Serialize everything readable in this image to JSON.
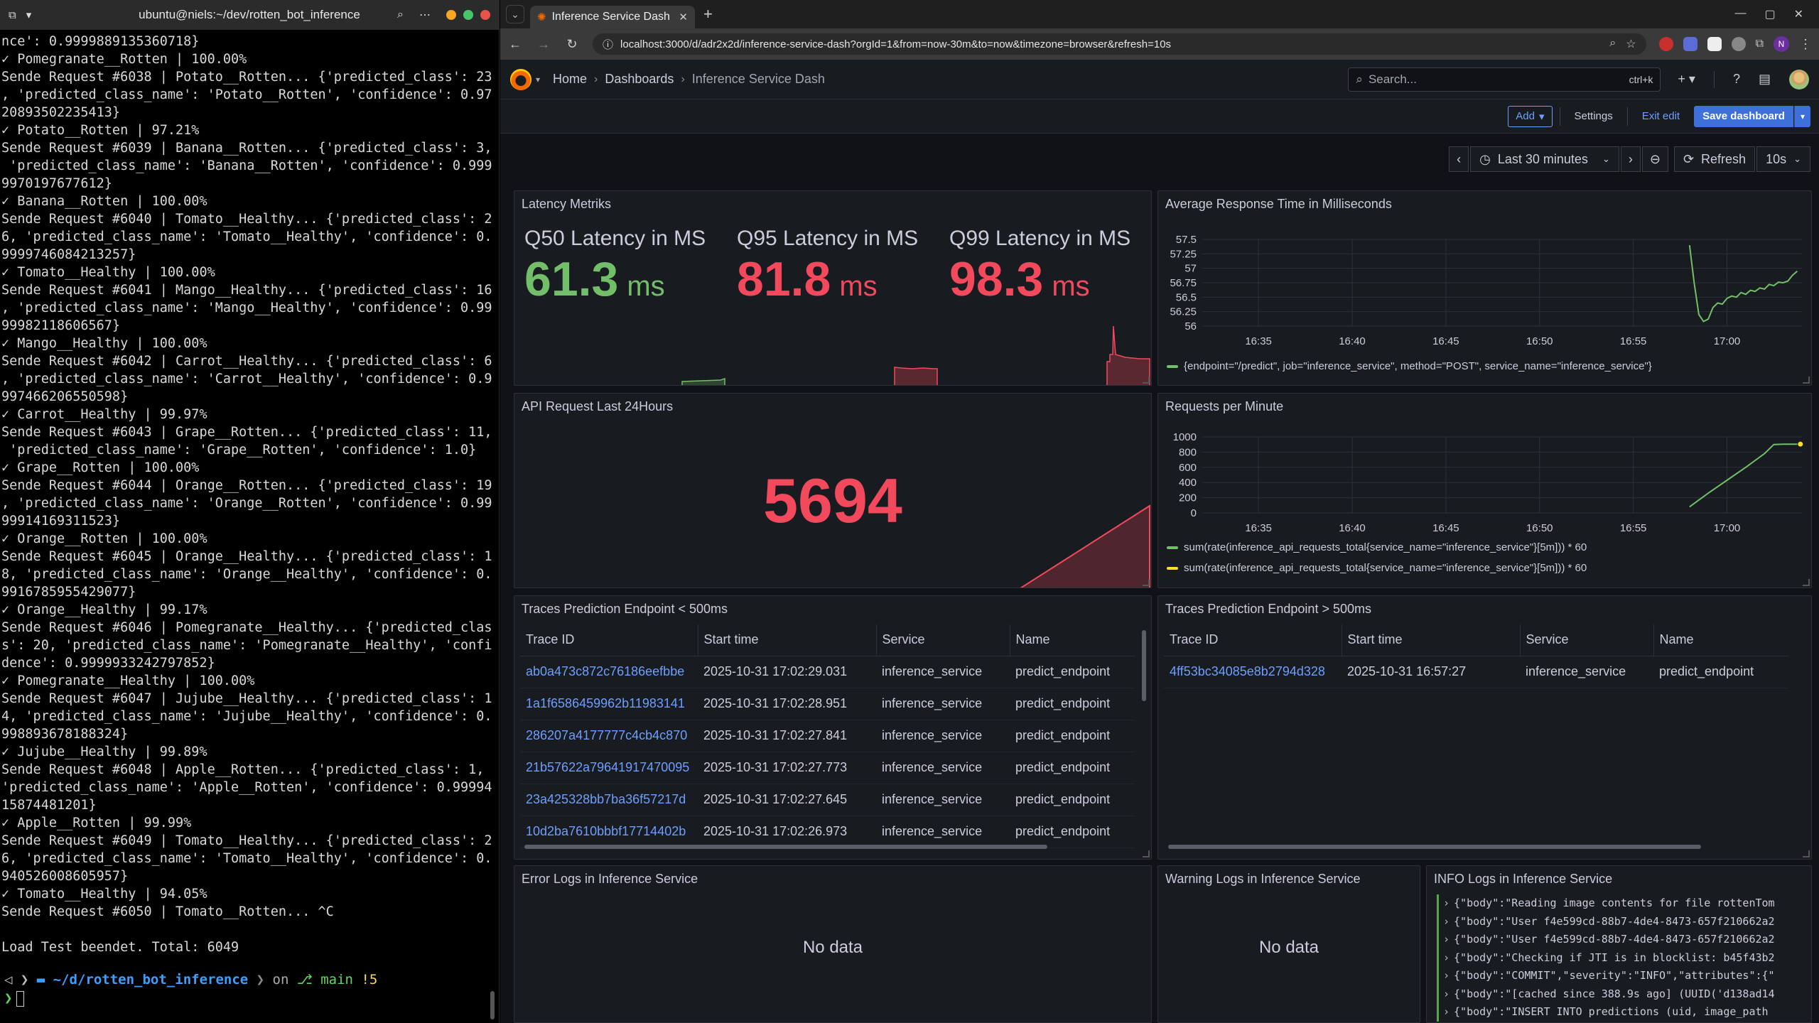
{
  "terminal": {
    "title": "ubuntu@niels:~/dev/rotten_bot_inference",
    "lines": [
      "nce': 0.9999889135360718}",
      "✓ Pomegranate__Rotten | 100.00%",
      "Sende Request #6038 | Potato__Rotten... {'predicted_class': 23",
      ", 'predicted_class_name': 'Potato__Rotten', 'confidence': 0.97",
      "20893502235413}",
      "✓ Potato__Rotten | 97.21%",
      "Sende Request #6039 | Banana__Rotten... {'predicted_class': 3,",
      " 'predicted_class_name': 'Banana__Rotten', 'confidence': 0.999",
      "9970197677612}",
      "✓ Banana__Rotten | 100.00%",
      "Sende Request #6040 | Tomato__Healthy... {'predicted_class': 2",
      "6, 'predicted_class_name': 'Tomato__Healthy', 'confidence': 0.",
      "9999746084213257}",
      "✓ Tomato__Healthy | 100.00%",
      "Sende Request #6041 | Mango__Healthy... {'predicted_class': 16",
      ", 'predicted_class_name': 'Mango__Healthy', 'confidence': 0.99",
      "99982118606567}",
      "✓ Mango__Healthy | 100.00%",
      "Sende Request #6042 | Carrot__Healthy... {'predicted_class': 6",
      ", 'predicted_class_name': 'Carrot__Healthy', 'confidence': 0.9",
      "997466206550598}",
      "✓ Carrot__Healthy | 99.97%",
      "Sende Request #6043 | Grape__Rotten... {'predicted_class': 11,",
      " 'predicted_class_name': 'Grape__Rotten', 'confidence': 1.0}",
      "✓ Grape__Rotten | 100.00%",
      "Sende Request #6044 | Orange__Rotten... {'predicted_class': 19",
      ", 'predicted_class_name': 'Orange__Rotten', 'confidence': 0.99",
      "99914169311523}",
      "✓ Orange__Rotten | 100.00%",
      "Sende Request #6045 | Orange__Healthy... {'predicted_class': 1",
      "8, 'predicted_class_name': 'Orange__Healthy', 'confidence': 0.",
      "9916785955429077}",
      "✓ Orange__Healthy | 99.17%",
      "Sende Request #6046 | Pomegranate__Healthy... {'predicted_clas",
      "s': 20, 'predicted_class_name': 'Pomegranate__Healthy', 'confi",
      "dence': 0.9999933242797852}",
      "✓ Pomegranate__Healthy | 100.00%",
      "Sende Request #6047 | Jujube__Healthy... {'predicted_class': 1",
      "4, 'predicted_class_name': 'Jujube__Healthy', 'confidence': 0.",
      "998893678188324}",
      "✓ Jujube__Healthy | 99.89%",
      "Sende Request #6048 | Apple__Rotten... {'predicted_class': 1,",
      "'predicted_class_name': 'Apple__Rotten', 'confidence': 0.99994",
      "15874481201}",
      "✓ Apple__Rotten | 99.99%",
      "Sende Request #6049 | Tomato__Healthy... {'predicted_class': 2",
      "6, 'predicted_class_name': 'Tomato__Healthy', 'confidence': 0.",
      "940526008605957}",
      "✓ Tomato__Healthy | 94.05%",
      "Sende Request #6050 | Tomato__Rotten... ^C",
      "",
      "Load Test beendet. Total: 6049"
    ],
    "prompt": {
      "dir_prefix": "~/d/",
      "dir_name": "rotten_bot_inference",
      "on": "on",
      "branch": "main",
      "status": "!5",
      "cursor_char": "❯"
    }
  },
  "browser": {
    "tab_title": "Inference Service Dash",
    "url": "localhost:3000/d/adr2x2d/inference-service-dash?orgId=1&from=now-30m&to=now&timezone=browser&refresh=10s",
    "profile_initial": "N"
  },
  "grafana": {
    "breadcrumbs": [
      "Home",
      "Dashboards",
      "Inference Service Dash"
    ],
    "search_placeholder": "Search...",
    "search_shortcut": "ctrl+k",
    "toolbar": {
      "add": "Add",
      "settings": "Settings",
      "exit_edit": "Exit edit",
      "save": "Save dashboard"
    },
    "timepicker": {
      "range": "Last 30 minutes",
      "refresh": "Refresh",
      "interval": "10s"
    },
    "colors": {
      "green": "#73bf69",
      "red": "#f2495c",
      "yellow": "#fade2a",
      "link": "#6e9fff"
    },
    "latency": {
      "title": "Latency Metriks",
      "stats": [
        {
          "label": "Q50 Latency in MS",
          "value": "61.3",
          "unit": "ms",
          "color": "#73bf69"
        },
        {
          "label": "Q95 Latency in MS",
          "value": "81.8",
          "unit": "ms",
          "color": "#f2495c"
        },
        {
          "label": "Q99 Latency in MS",
          "value": "98.3",
          "unit": "ms",
          "color": "#f2495c"
        }
      ]
    },
    "api_requests": {
      "title": "API Request Last 24Hours",
      "value": "5694"
    },
    "avg_response": {
      "title": "Average Response Time in Milliseconds",
      "legend": "{endpoint=\"/predict\", job=\"inference_service\", method=\"POST\", service_name=\"inference_service\"}"
    },
    "rpm": {
      "title": "Requests per Minute",
      "legend": [
        "sum(rate(inference_api_requests_total{service_name=\"inference_service\"}[5m])) * 60",
        "sum(rate(inference_api_requests_total{service_name=\"inference_service\"}[5m])) * 60"
      ]
    },
    "traces_fast": {
      "title": "Traces Prediction Endpoint < 500ms",
      "columns": [
        "Trace ID",
        "Start time",
        "Service",
        "Name"
      ],
      "rows": [
        [
          "ab0a473c872c76186eefbbe",
          "2025-10-31 17:02:29.031",
          "inference_service",
          "predict_endpoint"
        ],
        [
          "1a1f6586459962b11983141",
          "2025-10-31 17:02:28.951",
          "inference_service",
          "predict_endpoint"
        ],
        [
          "286207a4177777c4cb4c870",
          "2025-10-31 17:02:27.841",
          "inference_service",
          "predict_endpoint"
        ],
        [
          "21b57622a79641917470095",
          "2025-10-31 17:02:27.773",
          "inference_service",
          "predict_endpoint"
        ],
        [
          "23a425328bb7ba36f57217d",
          "2025-10-31 17:02:27.645",
          "inference_service",
          "predict_endpoint"
        ],
        [
          "10d2ba7610bbbf17714402b",
          "2025-10-31 17:02:26.973",
          "inference_service",
          "predict_endpoint"
        ]
      ]
    },
    "traces_slow": {
      "title": "Traces Prediction Endpoint > 500ms",
      "columns": [
        "Trace ID",
        "Start time",
        "Service",
        "Name"
      ],
      "rows": [
        [
          "4ff53bc34085e8b2794d328",
          "2025-10-31 16:57:27",
          "inference_service",
          "predict_endpoint"
        ]
      ]
    },
    "error_logs": {
      "title": "Error Logs in Inference Service",
      "empty": "No data"
    },
    "warning_logs": {
      "title": "Warning Logs in Inference Service",
      "empty": "No data"
    },
    "info_logs": {
      "title": "INFO Logs in Inference Service",
      "lines": [
        "{\"body\":\"Reading image contents for file rottenTom",
        "{\"body\":\"User f4e599cd-88b7-4de4-8473-657f210662a2",
        "{\"body\":\"User f4e599cd-88b7-4de4-8473-657f210662a2",
        "{\"body\":\"Checking if JTI is in blocklist: b45f43b2",
        "{\"body\":\"COMMIT\",\"severity\":\"INFO\",\"attributes\":{\"",
        "{\"body\":\"[cached since 388.9s ago] (UUID('d138ad14",
        "{\"body\":\"INSERT INTO predictions (uid, image_path"
      ]
    }
  },
  "chart_data": [
    {
      "type": "line",
      "title": "Average Response Time in Milliseconds",
      "x_ticks": [
        "16:35",
        "16:40",
        "16:45",
        "16:50",
        "16:55",
        "17:00"
      ],
      "y_ticks": [
        "56",
        "56.25",
        "56.5",
        "56.75",
        "57",
        "57.25",
        "57.5"
      ],
      "ylim": [
        56,
        57.5
      ],
      "xlim": [
        "16:32",
        "17:04"
      ],
      "series": [
        {
          "name": "{endpoint=\"/predict\", job=\"inference_service\", method=\"POST\", service_name=\"inference_service\"}",
          "color": "#73bf69",
          "x": [
            "16:58:00",
            "16:58:15",
            "16:58:30",
            "16:58:45",
            "16:59:00",
            "16:59:15",
            "16:59:30",
            "16:59:45",
            "17:00:00",
            "17:00:15",
            "17:00:30",
            "17:00:45",
            "17:01:00",
            "17:01:15",
            "17:01:30",
            "17:01:45",
            "17:02:00",
            "17:02:15",
            "17:02:30",
            "17:02:45",
            "17:03:00",
            "17:03:15",
            "17:03:30",
            "17:03:45"
          ],
          "values": [
            57.4,
            56.75,
            56.2,
            56.08,
            56.12,
            56.32,
            56.4,
            56.38,
            56.48,
            56.52,
            56.5,
            56.58,
            56.55,
            56.62,
            56.6,
            56.66,
            56.64,
            56.72,
            56.7,
            56.76,
            56.75,
            56.78,
            56.88,
            56.95
          ]
        }
      ]
    },
    {
      "type": "line",
      "title": "Requests per Minute",
      "x_ticks": [
        "16:35",
        "16:40",
        "16:45",
        "16:50",
        "16:55",
        "17:00"
      ],
      "y_ticks": [
        "0",
        "200",
        "400",
        "600",
        "800",
        "1000"
      ],
      "ylim": [
        0,
        1000
      ],
      "xlim": [
        "16:32",
        "17:04"
      ],
      "series": [
        {
          "name": "sum(rate(inference_api_requests_total{service_name=\"inference_service\"}[5m])) * 60",
          "color": "#73bf69",
          "x": [
            "16:58:00",
            "16:59:00",
            "17:00:00",
            "17:01:00",
            "17:02:00",
            "17:02:30",
            "17:03:00",
            "17:03:45"
          ],
          "values": [
            80,
            260,
            430,
            600,
            780,
            900,
            905,
            905
          ]
        },
        {
          "name": "sum(rate(inference_api_requests_total{service_name=\"inference_service\"}[5m])) * 60",
          "color": "#fade2a",
          "x": [
            "17:03:55"
          ],
          "values": [
            905
          ]
        }
      ]
    }
  ]
}
